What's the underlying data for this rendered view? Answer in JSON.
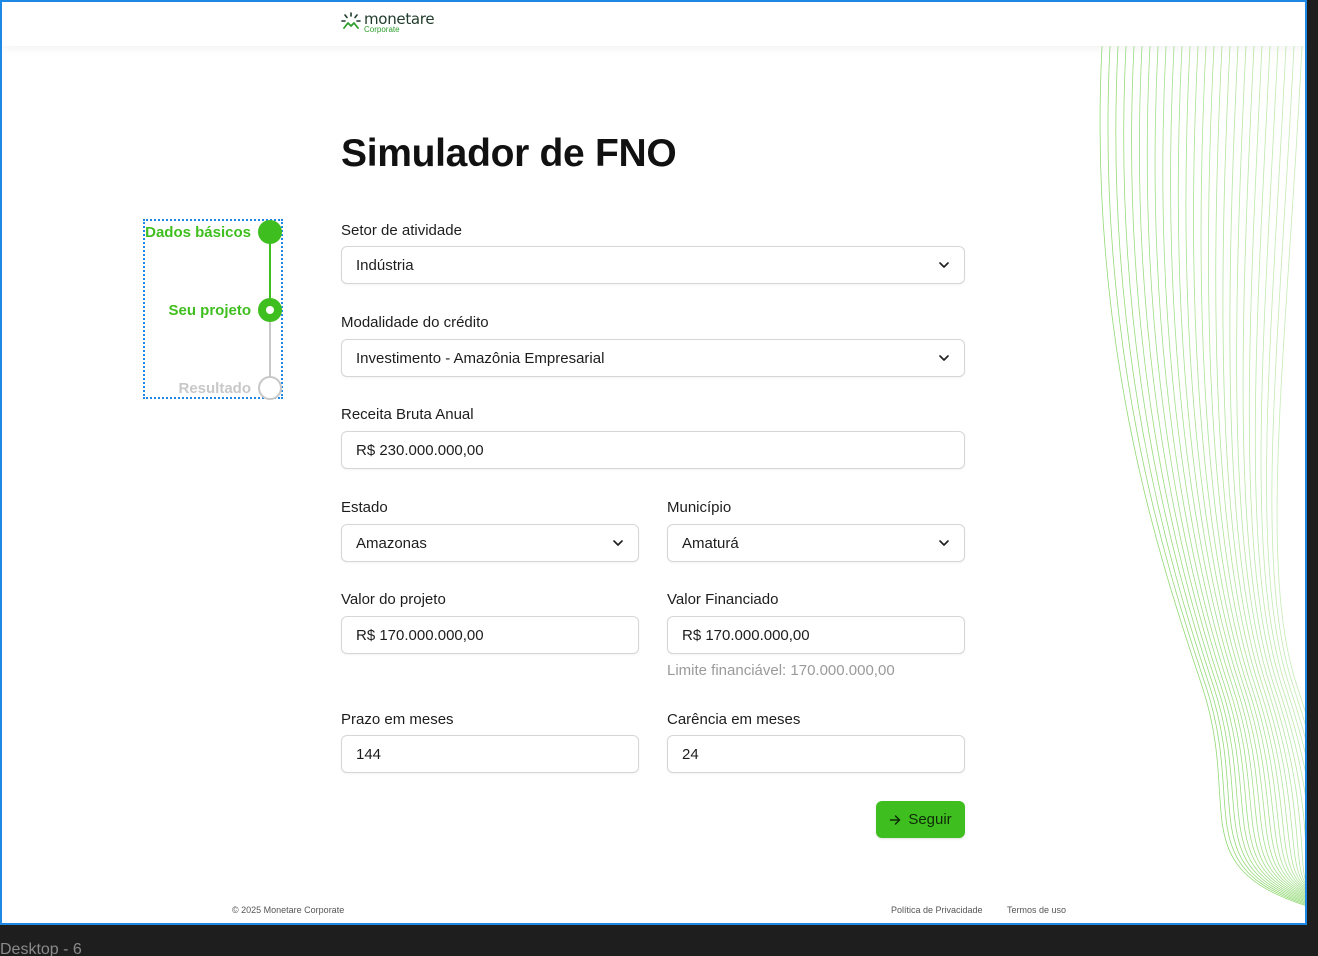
{
  "brand": {
    "name": "monetare",
    "sub": "Corporate"
  },
  "page": {
    "title": "Simulador de FNO"
  },
  "steps": [
    {
      "label": "Dados básicos",
      "state": "done"
    },
    {
      "label": "Seu projeto",
      "state": "current"
    },
    {
      "label": "Resultado",
      "state": "pending"
    }
  ],
  "form": {
    "setor": {
      "label": "Setor de atividade",
      "value": "Indústria"
    },
    "modalidade": {
      "label": "Modalidade do crédito",
      "value": "Investimento - Amazônia Empresarial"
    },
    "receita": {
      "label": "Receita Bruta Anual",
      "value": "R$ 230.000.000,00"
    },
    "estado": {
      "label": "Estado",
      "value": "Amazonas"
    },
    "municipio": {
      "label": "Município",
      "value": "Amaturá"
    },
    "valor_projeto": {
      "label": "Valor do projeto",
      "value": "R$ 170.000.000,00"
    },
    "valor_financiado": {
      "label": "Valor Financiado",
      "value": "R$ 170.000.000,00",
      "hint": "Limite financiável: 170.000.000,00"
    },
    "prazo": {
      "label": "Prazo em meses",
      "value": "144"
    },
    "carencia": {
      "label": "Carência em meses",
      "value": "24"
    }
  },
  "actions": {
    "next_label": "Seguir",
    "next_icon": "arrow-right-icon"
  },
  "footer": {
    "copyright": "© 2025 Monetare Corporate",
    "privacy": "Política de Privacidade",
    "terms": "Termos de uso"
  },
  "canvas_label": "Desktop - 6",
  "colors": {
    "accent": "#3fbf1f",
    "pending": "#c8c8c8",
    "frame": "#1e88e5"
  }
}
